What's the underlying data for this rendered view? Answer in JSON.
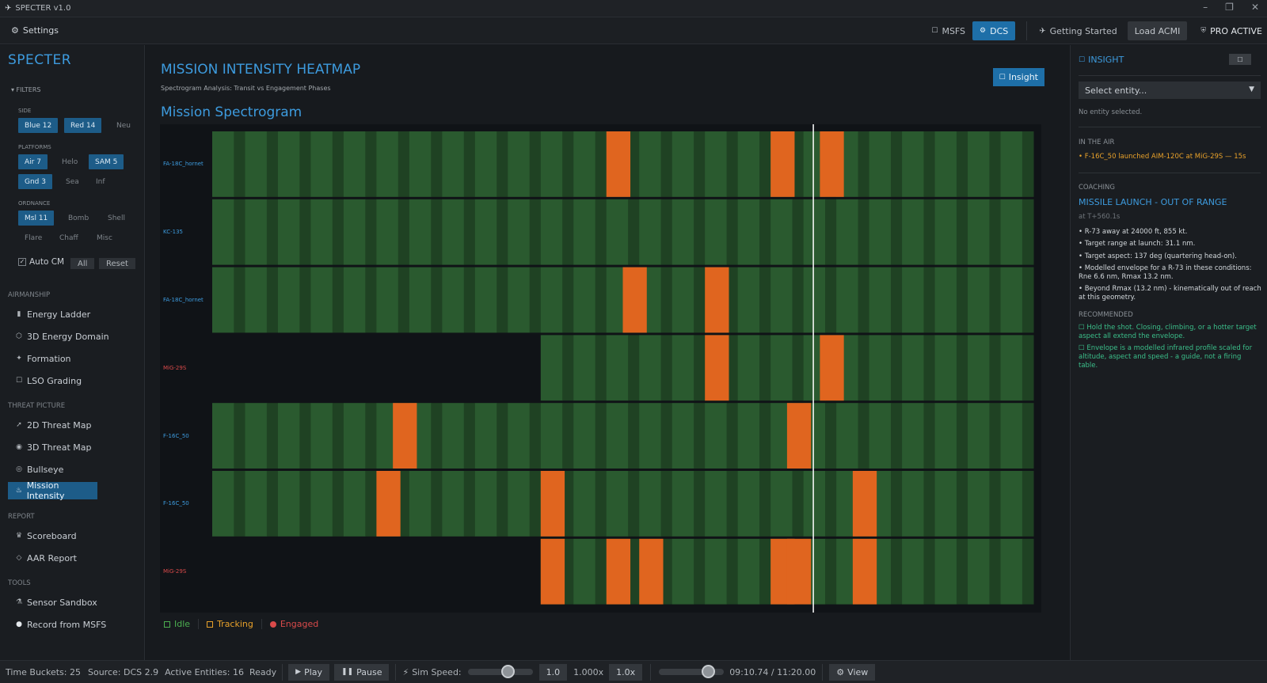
{
  "window": {
    "title": "SPECTER v1.0",
    "controls": [
      "–",
      "❐",
      "✕"
    ]
  },
  "topbar": {
    "settings": "Settings",
    "sim_tabs": [
      {
        "label": "MSFS",
        "active": false
      },
      {
        "label": "DCS",
        "active": true
      }
    ],
    "getting_started": "Getting Started",
    "load_acmi": "Load ACMI",
    "pro": "PRO ACTIVE"
  },
  "sidebar": {
    "brand": "SPECTER",
    "filters_header": "▾ FILTERS",
    "groups": {
      "side": "SIDE",
      "platforms": "PLATFORMS",
      "ordnance": "ORDNANCE"
    },
    "chips": {
      "blue": "Blue  12",
      "red": "Red  14",
      "neu": "Neu",
      "air": "Air  7",
      "helo": "Helo",
      "sam": "SAM  5",
      "gnd": "Gnd  3",
      "sea": "Sea",
      "inf": "Inf",
      "msl": "Msl  11",
      "bomb": "Bomb",
      "shell": "Shell",
      "flare": "Flare",
      "chaff": "Chaff",
      "misc": "Misc"
    },
    "auto_cm": "Auto CM",
    "all_btn": "All",
    "reset_btn": "Reset",
    "sections": {
      "airmanship": "AIRMANSHIP",
      "threat": "THREAT PICTURE",
      "report": "REPORT",
      "tools": "TOOLS"
    },
    "nav": {
      "energy_ladder": "Energy Ladder",
      "energy_3d": "3D Energy Domain",
      "formation": "Formation",
      "lso": "LSO Grading",
      "threat2d": "2D Threat Map",
      "threat3d": "3D Threat Map",
      "bullseye": "Bullseye",
      "mission_intensity": "Mission Intensity",
      "scoreboard": "Scoreboard",
      "aar": "AAR Report",
      "sensor": "Sensor Sandbox",
      "record": "Record from MSFS"
    }
  },
  "main": {
    "title": "MISSION INTENSITY HEATMAP",
    "subtitle": "Spectrogram Analysis: Transit vs Engagement Phases",
    "insight_btn": "Insight",
    "spectrogram_title": "Mission Spectrogram",
    "rows": [
      {
        "label": "FA-18C_hornet",
        "side": "blue",
        "start": 0,
        "engaged": [
          12,
          17,
          18.5
        ]
      },
      {
        "label": "KC-135",
        "side": "blue",
        "start": 0,
        "engaged": []
      },
      {
        "label": "FA-18C_hornet",
        "side": "blue",
        "start": 0,
        "engaged": [
          12.5,
          15
        ]
      },
      {
        "label": "MiG-29S",
        "side": "red",
        "start": 10,
        "engaged": [
          15,
          18.5
        ]
      },
      {
        "label": "F-16C_50",
        "side": "blue",
        "start": 0,
        "engaged": [
          5.5,
          17.5
        ]
      },
      {
        "label": "F-16C_50",
        "side": "blue",
        "start": 0,
        "engaged": [
          5,
          10,
          19.5
        ]
      },
      {
        "label": "MiG-29S",
        "side": "red",
        "start": 10,
        "engaged": [
          10,
          12,
          13,
          17,
          17.5,
          19.5
        ]
      }
    ],
    "buckets": 25,
    "cursor_bucket": 18.3,
    "legend": {
      "idle": "Idle",
      "tracking": "Tracking",
      "engaged": "Engaged"
    },
    "colors": {
      "idle_light": "#2a5a2f",
      "idle_dark": "#1f4223",
      "engaged": "#e0651f",
      "blue": "#3d9bde",
      "red": "#d94a4a"
    }
  },
  "right": {
    "title": "INSIGHT",
    "select_placeholder": "Select entity...",
    "no_entity": "No entity selected.",
    "in_air_label": "IN THE AIR",
    "in_air_item": "• F-16C_50 launched AIM-120C at MiG-29S — 15s",
    "coaching_label": "COACHING",
    "coaching_title": "MISSILE LAUNCH - OUT OF RANGE",
    "coaching_time": "at T+560.1s",
    "bullets": [
      "• R-73 away at 24000 ft, 855 kt.",
      "• Target range at launch: 31.1 nm.",
      "• Target aspect: 137 deg (quartering head-on).",
      "• Modelled envelope for a R-73 in these conditions: Rne 6.6 nm, Rmax 13.2 nm.",
      "• Beyond Rmax (13.2 nm) - kinematically out of reach at this geometry."
    ],
    "recommended_label": "RECOMMENDED",
    "recommended": [
      "☐ Hold the shot. Closing, climbing, or a hotter target aspect all extend the envelope.",
      "☐ Envelope is a modelled infrared profile scaled for altitude, aspect and speed - a guide, not a firing table."
    ]
  },
  "status": {
    "buckets": "Time Buckets: 25",
    "source": "Source: DCS 2.9",
    "entities": "Active Entities: 16",
    "ready": "Ready",
    "play": "Play",
    "pause": "Pause",
    "sim_speed": "Sim Speed:",
    "speed_val": "1.0",
    "speed_x": "1.000x",
    "speed_btn": "1.0x",
    "time": "09:10.74 / 11:20.00",
    "view": "View"
  }
}
